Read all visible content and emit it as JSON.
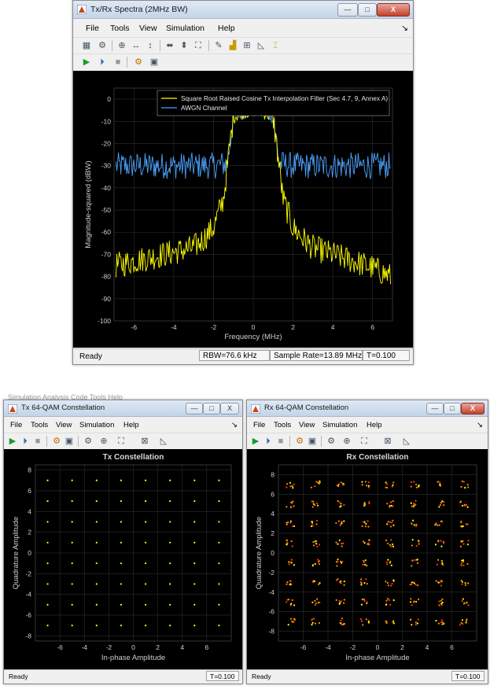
{
  "spectrum_window": {
    "title": "Tx/Rx Spectra (2MHz BW)",
    "controls": {
      "minimize": "—",
      "maximize": "□",
      "close": "X"
    },
    "menu": [
      "File",
      "Tools",
      "View",
      "Simulation",
      "Help"
    ],
    "menu_overflow": "↘",
    "toolbar1_icons": [
      "save-icon",
      "settings-gear-icon",
      "zoom-in-icon",
      "zoom-x-icon",
      "zoom-y-icon",
      "scale-x-icon",
      "scale-y-icon",
      "autoscale-icon",
      "edit-icon",
      "peak-finder-icon",
      "cursor-measure-icon",
      "channel-measure-icon",
      "distortion-measure-icon"
    ],
    "toolbar2_icons": [
      "run-icon",
      "step-forward-icon",
      "stop-icon",
      "highlight-simulink-icon",
      "snapshot-icon"
    ],
    "status": {
      "ready": "Ready",
      "rbw": "RBW=76.6 kHz",
      "sample_rate": "Sample Rate=13.89 MHz",
      "time": "T=0.100"
    },
    "chart_data": {
      "type": "line",
      "xlabel": "Frequency (MHz)",
      "ylabel": "Magnitude-squared (dBW)",
      "xlim": [
        -7,
        7
      ],
      "ylim": [
        -100,
        5
      ],
      "xticks": [
        "-6",
        "-4",
        "-2",
        "0",
        "2",
        "4",
        "6"
      ],
      "yticks": [
        "0",
        "-10",
        "-20",
        "-30",
        "-40",
        "-50",
        "-60",
        "-70",
        "-80",
        "-90",
        "-100"
      ],
      "grid": true,
      "legend_position": "top-right",
      "series": [
        {
          "name": "Square Root Raised Cosine Tx Interpolation Filter (Sec 4.7, 9, Annex A)",
          "color": "#ffff00",
          "x": [
            -6.9,
            -6,
            -5,
            -4,
            -3,
            -2.5,
            -2,
            -1.5,
            -1.3,
            -1.1,
            -1,
            -0.5,
            0,
            0.5,
            1,
            1.1,
            1.3,
            1.5,
            2,
            2.5,
            3,
            4,
            5,
            6,
            6.9
          ],
          "y": [
            -75,
            -73,
            -71,
            -69,
            -67,
            -63,
            -58,
            -45,
            -30,
            -15,
            -8,
            -6,
            -5,
            -6,
            -8,
            -15,
            -30,
            -45,
            -58,
            -63,
            -67,
            -70,
            -73,
            -76,
            -80
          ]
        },
        {
          "name": "AWGN Channel",
          "color": "#4aa3ff",
          "x": [
            -6.9,
            -5,
            -3,
            -2,
            -1.3,
            -1.1,
            -1,
            -0.5,
            0,
            0.5,
            1,
            1.1,
            1.3,
            2,
            3,
            5,
            6.9
          ],
          "y": [
            -30,
            -30,
            -30,
            -30,
            -29,
            -15,
            -8,
            -6,
            -5,
            -6,
            -8,
            -15,
            -29,
            -30,
            -30,
            -30,
            -30
          ]
        }
      ]
    }
  },
  "background_menu": "Simulation   Analysis   Code   Tools   Help",
  "tx_window": {
    "title": "Tx 64-QAM Constellation",
    "controls": {
      "minimize": "—",
      "maximize": "□",
      "close": "X"
    },
    "menu": [
      "File",
      "Tools",
      "View",
      "Simulation",
      "Help"
    ],
    "menu_overflow": "↘",
    "toolbar_icons": [
      "run-icon",
      "step-forward-icon",
      "stop-icon",
      "highlight-simulink-icon",
      "snapshot-icon",
      "settings-gear-icon",
      "zoom-in-icon",
      "autoscale-icon",
      "expand-icon",
      "measure-icon"
    ],
    "status": {
      "ready": "Ready",
      "time": "T=0.100"
    },
    "chart_data": {
      "type": "scatter",
      "title": "Tx Constellation",
      "xlabel": "In-phase Amplitude",
      "ylabel": "Quadrature Amplitude",
      "xlim": [
        -8,
        8
      ],
      "ylim": [
        -8.5,
        8.5
      ],
      "xticks": [
        "-6",
        "-4",
        "-2",
        "0",
        "2",
        "4",
        "6"
      ],
      "yticks": [
        "8",
        "6",
        "4",
        "2",
        "0",
        "-2",
        "-4",
        "-6",
        "-8"
      ],
      "grid": true,
      "color": "#ffff00",
      "levels": [
        -7,
        -5,
        -3,
        -1,
        1,
        3,
        5,
        7
      ]
    }
  },
  "rx_window": {
    "title": "Rx 64-QAM Constellation",
    "controls": {
      "minimize": "—",
      "maximize": "□",
      "close": "X"
    },
    "menu": [
      "File",
      "Tools",
      "View",
      "Simulation",
      "Help"
    ],
    "menu_overflow": "↘",
    "toolbar_icons": [
      "run-icon",
      "step-forward-icon",
      "stop-icon",
      "highlight-simulink-icon",
      "snapshot-icon",
      "settings-gear-icon",
      "zoom-in-icon",
      "autoscale-icon",
      "expand-icon",
      "measure-icon"
    ],
    "status": {
      "ready": "Ready",
      "time": "T=0.100"
    },
    "chart_data": {
      "type": "scatter",
      "title": "Rx Constellation",
      "xlabel": "In-phase Amplitude",
      "ylabel": "Quadrature Amplitude",
      "xlim": [
        -8,
        8
      ],
      "ylim": [
        -9,
        9
      ],
      "xticks": [
        "-6",
        "-4",
        "-2",
        "0",
        "2",
        "4",
        "6"
      ],
      "yticks": [
        "8",
        "6",
        "4",
        "2",
        "0",
        "-2",
        "-4",
        "-6",
        "-8"
      ],
      "grid": true,
      "colors": [
        "#ff8a00",
        "#ffff00",
        "#ff3b1a"
      ],
      "levels": [
        -7,
        -5,
        -3,
        -1,
        1,
        3,
        5,
        7
      ]
    }
  }
}
